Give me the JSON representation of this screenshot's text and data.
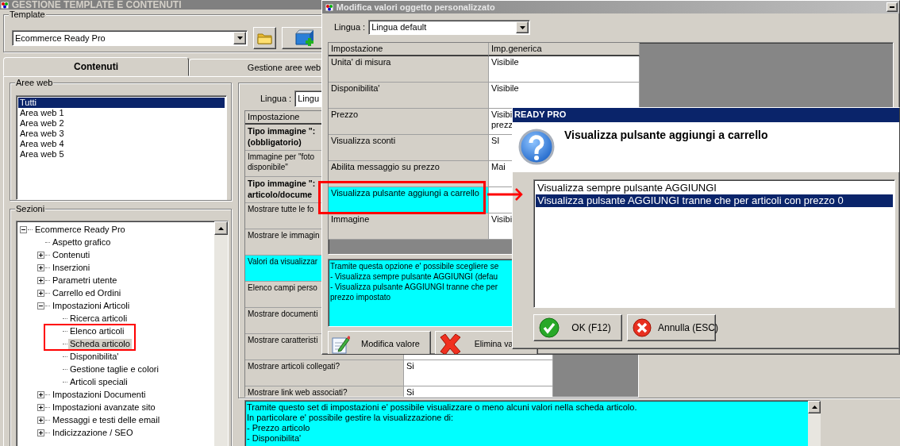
{
  "main_window": {
    "title": "GESTIONE TEMPLATE E CONTENUTI",
    "template": {
      "label": "Template",
      "value": "Ecommerce Ready Pro"
    },
    "tabs": [
      {
        "label": "Contenuti",
        "selected": true
      },
      {
        "label": "Gestione aree web",
        "selected": false
      }
    ],
    "aree_web": {
      "label": "Aree web",
      "items": [
        {
          "label": "Tutti",
          "selected": true
        },
        {
          "label": "Area web 1",
          "selected": false
        },
        {
          "label": "Area web 2",
          "selected": false
        },
        {
          "label": "Area web 3",
          "selected": false
        },
        {
          "label": "Area web 4",
          "selected": false
        },
        {
          "label": "Area web 5",
          "selected": false
        }
      ]
    },
    "sezioni": {
      "label": "Sezioni",
      "tree": [
        {
          "label": "Ecommerce Ready Pro",
          "expanded": true,
          "selected": false,
          "children": [
            {
              "label": "Aspetto grafico",
              "selected": false
            },
            {
              "label": "Contenuti",
              "expanded": false,
              "selected": false
            },
            {
              "label": "Inserzioni",
              "expanded": false,
              "selected": false
            },
            {
              "label": "Parametri utente",
              "expanded": false,
              "selected": false
            },
            {
              "label": "Carrello ed Ordini",
              "expanded": false,
              "selected": false
            },
            {
              "label": "Impostazioni Articoli",
              "expanded": true,
              "selected": false,
              "children": [
                {
                  "label": "Ricerca articoli",
                  "selected": false
                },
                {
                  "label": "Elenco articoli",
                  "selected": false
                },
                {
                  "label": "Scheda articolo",
                  "selected": true
                },
                {
                  "label": "Disponibilita'",
                  "selected": false
                },
                {
                  "label": "Gestione taglie e colori",
                  "selected": false
                },
                {
                  "label": "Articoli speciali",
                  "selected": false
                }
              ]
            },
            {
              "label": "Impostazioni Documenti",
              "expanded": false,
              "selected": false
            },
            {
              "label": "Impostazioni avanzate sito",
              "expanded": false,
              "selected": false
            },
            {
              "label": "Messaggi e testi delle email",
              "expanded": false,
              "selected": false
            },
            {
              "label": "Indicizzazione / SEO",
              "expanded": false,
              "selected": false
            }
          ]
        }
      ]
    },
    "lingua": {
      "label": "Lingua :",
      "value": "Lingu"
    },
    "grid": {
      "columns": [
        "Impostazione"
      ],
      "rows": [
        {
          "setting": "Tipo immagine \":\n(obbligatorio)",
          "bold": true,
          "highlighted": false
        },
        {
          "setting": "Immagine per \"foto\ndisponibile\"",
          "bold": false,
          "highlighted": false
        },
        {
          "setting": "Tipo immagine \":\narticolo/docume",
          "bold": true,
          "highlighted": false
        },
        {
          "setting": "Mostrare tutte le fo",
          "bold": false,
          "highlighted": false
        },
        {
          "setting": "Mostrare le immagin",
          "bold": false,
          "highlighted": false
        },
        {
          "setting": "Valori da visualizzar",
          "bold": false,
          "highlighted": true
        },
        {
          "setting": "Elenco campi perso",
          "bold": false,
          "highlighted": false
        },
        {
          "setting": "Mostrare documenti",
          "bold": false,
          "highlighted": false
        },
        {
          "setting": "Mostrare caratteristi",
          "bold": false,
          "highlighted": false
        },
        {
          "setting": "Mostrare articoli collegati?",
          "value": "Si",
          "bold": false,
          "highlighted": false
        },
        {
          "setting": "Mostrare link web associati?",
          "value": "Si",
          "bold": false,
          "highlighted": false
        }
      ]
    },
    "description": "Tramite questo set di impostazioni e' possibile visualizzare o meno alcuni valori nella scheda articolo.\nIn particolare e' possibile gestire la visualizzazione di:\n- Prezzo articolo\n- Disponibilita'"
  },
  "edit_dialog": {
    "title": "Modifica valori oggetto personalizzato",
    "lingua": {
      "label": "Lingua :",
      "value": "Lingua default"
    },
    "grid": {
      "columns": [
        "Impostazione",
        "Imp.generica"
      ],
      "rows": [
        {
          "setting": "Unita' di misura",
          "value": "Visibile",
          "highlighted": false
        },
        {
          "setting": "Disponibilita'",
          "value": "Visibile",
          "highlighted": false
        },
        {
          "setting": "Prezzo",
          "value": "Visibi\nprezz",
          "highlighted": false
        },
        {
          "setting": "Visualizza sconti",
          "value": "SI",
          "highlighted": false
        },
        {
          "setting": "Abilita messaggio su prezzo",
          "value": "Mai",
          "highlighted": false
        },
        {
          "setting": "Visualizza pulsante aggiungi a carrello",
          "highlighted": true
        },
        {
          "setting": "Immagine",
          "value": "Visibi",
          "highlighted": false
        }
      ]
    },
    "description": "Tramite questa opzione e' possibile scegliere se\n- Visualizza sempre pulsante AGGIUNGI (defau\n- Visualizza pulsante AGGIUNGI tranne che per\nprezzo impostato",
    "buttons": [
      {
        "label": "Modifica valore",
        "kind": "edit"
      },
      {
        "label": "Elimina va",
        "kind": "delete"
      }
    ]
  },
  "message_box": {
    "title": "READY PRO",
    "heading": "Visualizza pulsante aggiungi a carrello",
    "options": [
      {
        "label": "Visualizza sempre pulsante AGGIUNGI",
        "selected": false
      },
      {
        "label": "Visualizza pulsante AGGIUNGI tranne che per articoli con prezzo 0",
        "selected": true
      }
    ],
    "buttons": [
      {
        "label": "OK (F12)",
        "kind": "ok"
      },
      {
        "label": "Annulla (ESC)",
        "kind": "cancel"
      }
    ]
  }
}
